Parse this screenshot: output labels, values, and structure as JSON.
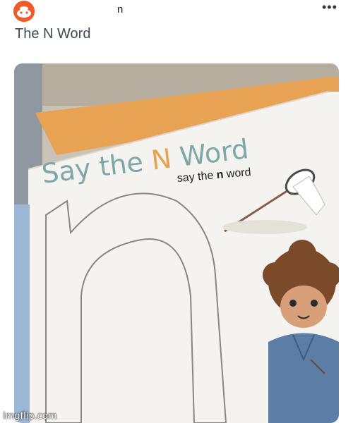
{
  "header": {
    "avatar_icon": "reddit-style-avatar-icon",
    "username": "n",
    "more_icon": "more-options-icon",
    "more_glyph": "•••"
  },
  "post": {
    "title": "The N Word"
  },
  "photo": {
    "heading_prefix": "Say the ",
    "heading_letter": "N",
    "heading_suffix": " Word",
    "subtitle_prefix": "say the ",
    "subtitle_bold": "n",
    "subtitle_suffix": " word",
    "big_letter": "n",
    "accent_color": "#e8a254",
    "heading_color": "#7fa7a8"
  },
  "footer": {
    "watermark": "imgflip.com"
  }
}
